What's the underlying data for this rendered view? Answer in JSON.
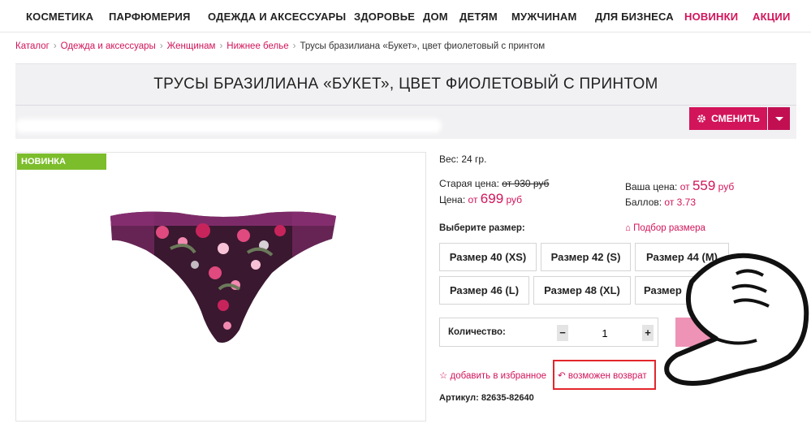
{
  "nav": {
    "items": [
      {
        "label": "КОСМЕТИКА",
        "accent": false
      },
      {
        "label": "ПАРФЮМЕРИЯ",
        "accent": false
      },
      {
        "label": "ОДЕЖДА И АКСЕССУАРЫ",
        "accent": false
      },
      {
        "label": "ЗДОРОВЬЕ",
        "accent": false
      },
      {
        "label": "ДОМ",
        "accent": false
      },
      {
        "label": "ДЕТЯМ",
        "accent": false
      },
      {
        "label": "МУЖЧИНАМ",
        "accent": false
      },
      {
        "label": "ДЛЯ БИЗНЕСА",
        "accent": false
      },
      {
        "label": "НОВИНКИ",
        "accent": true
      },
      {
        "label": "АКЦИИ",
        "accent": true
      }
    ]
  },
  "breadcrumb": {
    "items": [
      "Каталог",
      "Одежда и аксессуары",
      "Женщинам",
      "Нижнее белье"
    ],
    "current": "Трусы бразилиана «Букет», цвет фиолетовый с принтом"
  },
  "product": {
    "title": "ТРУСЫ БРАЗИЛИАНА «БУКЕТ», ЦВЕТ ФИОЛЕТОВЫЙ С ПРИНТОМ",
    "badge": "НОВИНКА",
    "weight": "Вес: 24 гр.",
    "old_price_label": "Старая цена:",
    "old_price_value": "от 930 руб",
    "price_label": "Цена:",
    "price_from": "от",
    "price_value": "699",
    "price_currency": "руб",
    "your_price_label": "Ваша цена:",
    "your_price_from": "от",
    "your_price_value": "559",
    "your_price_currency": "руб",
    "points_label": "Баллов:",
    "points_value": "от 3.73",
    "choose_size_label": "Выберите размер:",
    "size_guide_label": "Подбор размера",
    "sizes": [
      "Размер 40 (XS)",
      "Размер 42 (S)",
      "Размер 44 (M)",
      "Размер 46 (L)",
      "Размер 48 (XL)",
      "Размер"
    ],
    "quantity_label": "Количество:",
    "quantity_value": "1",
    "minus": "−",
    "plus": "+",
    "favorite_label": "добавить в избранное",
    "return_label": "возможен возврат",
    "article": "Артикул: 82635-82640"
  },
  "change_button": {
    "label": "СМЕНИТЬ"
  },
  "colors": {
    "accent": "#d2145a",
    "badge_green": "#7cbd2b",
    "title_bg": "#f1f1f3",
    "cart_pink": "#ee93b5",
    "highlight_red": "#e3262c"
  },
  "icons": [
    "gear-icon",
    "caret-down-icon",
    "chevron-right-icon",
    "star-icon",
    "return-arrow-icon",
    "ruler-icon"
  ]
}
